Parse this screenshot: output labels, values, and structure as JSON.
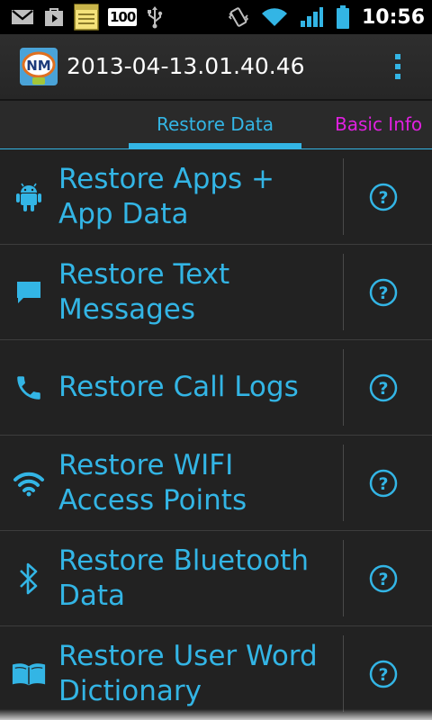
{
  "status_bar": {
    "battery_percent": "100",
    "time": "10:56",
    "icons": [
      "gmail-icon",
      "play-store-icon",
      "notes-icon",
      "usb-icon",
      "vibrate-icon",
      "wifi-icon",
      "signal-icon",
      "battery-icon"
    ]
  },
  "action_bar": {
    "app_icon_text": "NM",
    "title": "2013-04-13.01.40.46",
    "overflow_icon": "overflow-menu-icon"
  },
  "tabs": [
    {
      "label": "Restore Data",
      "selected": true
    },
    {
      "label": "Basic Info",
      "selected": false
    }
  ],
  "list": [
    {
      "label": "Restore Apps + App Data",
      "icon": "android-icon"
    },
    {
      "label": "Restore Text Messages",
      "icon": "message-icon"
    },
    {
      "label": "Restore Call Logs",
      "icon": "phone-icon"
    },
    {
      "label": "Restore WIFI Access Points",
      "icon": "wifi-icon"
    },
    {
      "label": "Restore Bluetooth Data",
      "icon": "bluetooth-icon"
    },
    {
      "label": "Restore User Word Dictionary",
      "icon": "book-icon"
    }
  ],
  "help_label": "?",
  "colors": {
    "accent": "#33b5e5",
    "tab_inactive": "#e020e0",
    "background": "#222222"
  }
}
